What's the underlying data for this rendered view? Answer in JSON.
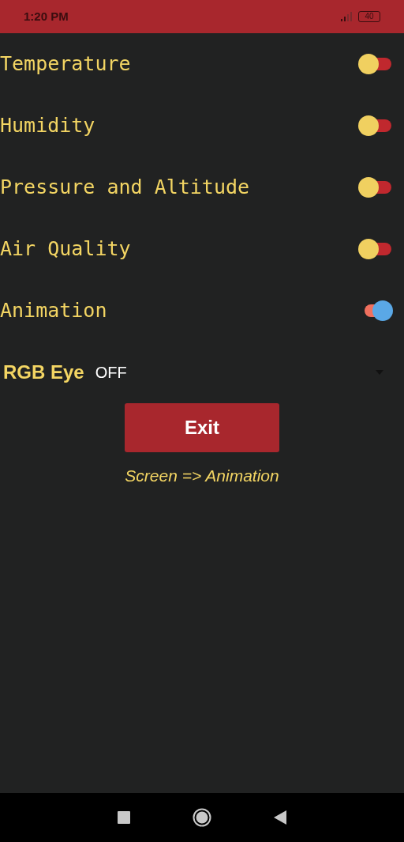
{
  "status_bar": {
    "time": "1:20 PM",
    "battery": "40"
  },
  "toggles": [
    {
      "label": "Temperature",
      "on": false
    },
    {
      "label": "Humidity",
      "on": false
    },
    {
      "label": "Pressure and Altitude",
      "on": false
    },
    {
      "label": "Air Quality",
      "on": false
    },
    {
      "label": "Animation",
      "on": true
    }
  ],
  "dropdown": {
    "label": "RGB Eye",
    "value": "OFF"
  },
  "exit_button": "Exit",
  "caption": "Screen => Animation"
}
